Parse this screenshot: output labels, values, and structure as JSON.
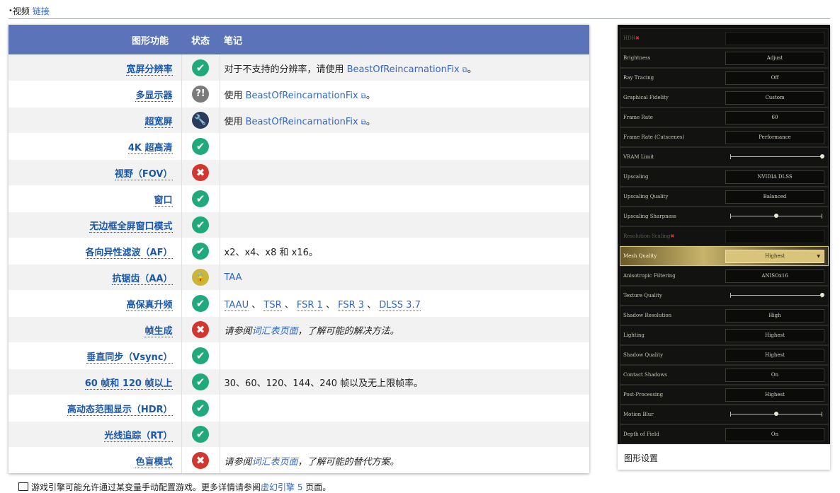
{
  "breadcrumb": {
    "bullet": "•",
    "text": "视频",
    "link": "链接"
  },
  "table": {
    "headers": {
      "feature": "图形功能",
      "status": "状态",
      "notes": "笔记"
    },
    "rows": [
      {
        "feature": "宽屏分辨率",
        "status": "true",
        "notes": {
          "pre": "对于不支持的分辨率，请使用 ",
          "link": "BeastOfReincarnationFix",
          "post": "。"
        }
      },
      {
        "feature": "多显示器",
        "status": "unknown",
        "notes": {
          "pre": "使用 ",
          "link": "BeastOfReincarnationFix",
          "post": "。"
        }
      },
      {
        "feature": "超宽屏",
        "status": "hackable",
        "notes": {
          "pre": "使用 ",
          "link": "BeastOfReincarnationFix",
          "post": "。"
        }
      },
      {
        "feature": "4K 超高清",
        "status": "true",
        "notes": {
          "pre": "",
          "link": "",
          "post": ""
        }
      },
      {
        "feature": "视野（FOV）",
        "status": "false",
        "notes": {
          "pre": "",
          "link": "",
          "post": ""
        }
      },
      {
        "feature": "窗口",
        "status": "true",
        "notes": {
          "pre": "",
          "link": "",
          "post": ""
        }
      },
      {
        "feature": "无边框全屏窗口模式",
        "status": "true",
        "notes": {
          "pre": "",
          "link": "",
          "post": ""
        }
      },
      {
        "feature": "各向异性滤波（AF）",
        "status": "true",
        "notes": {
          "pre": "x2、x4、x8 和 x16。",
          "link": "",
          "post": ""
        }
      },
      {
        "feature": "抗锯齿（AA）",
        "status": "limited",
        "notes": {
          "pre": "",
          "link": "TAA",
          "post": ""
        }
      },
      {
        "feature": "高保真升频",
        "status": "true",
        "notes": {
          "upscalers": [
            "TAAU",
            "TSR",
            "FSR 1",
            "FSR 3",
            "DLSS 3.7"
          ],
          "sep": " 、 "
        }
      },
      {
        "feature": "帧生成",
        "status": "false",
        "notes": {
          "italic_pre": "请参阅",
          "italic_link": "词汇表页面",
          "italic_post": "，了解可能的解决方法。"
        }
      },
      {
        "feature": "垂直同步（Vsync）",
        "status": "true",
        "notes": {
          "pre": "",
          "link": "",
          "post": ""
        }
      },
      {
        "feature": "60 帧和 120 帧以上",
        "status": "true",
        "notes": {
          "pre": "30、60、120、144、240 帧以及无上限帧率。",
          "link": "",
          "post": ""
        }
      },
      {
        "feature": "高动态范围显示（HDR）",
        "status": "true",
        "notes": {
          "pre": "",
          "link": "",
          "post": ""
        }
      },
      {
        "feature": "光线追踪（RT）",
        "status": "true",
        "notes": {
          "pre": "",
          "link": "",
          "post": ""
        }
      },
      {
        "feature": "色盲模式",
        "status": "false",
        "notes": {
          "italic_pre": "请参阅",
          "italic_link": "词汇表页面",
          "italic_post": "，了解可能的替代方案。"
        }
      }
    ]
  },
  "status_icons": {
    "true": "✔",
    "false": "✖",
    "unknown": "?!",
    "hackable": "🔧",
    "limited": "🔒"
  },
  "status_icon_names": {
    "true": "check-circle-icon",
    "false": "cross-circle-icon",
    "unknown": "unknown-status-icon",
    "hackable": "wrench-icon",
    "limited": "lock-icon"
  },
  "external_link_icon": "⧉",
  "note": {
    "icon": "notes-icon",
    "pre": "游戏引擎可能允许通过某变量手动配置游戏。更多详情请参阅",
    "link": "虚幻引擎 5",
    "post": " 页面。"
  },
  "figure": {
    "caption": "图形设置",
    "settings": [
      {
        "label": "HDR",
        "required": true,
        "value": "",
        "dim": true,
        "type": "select"
      },
      {
        "label": "Brightness",
        "value": "Adjust",
        "type": "select"
      },
      {
        "label": "Ray Tracing",
        "value": "Off",
        "type": "select"
      },
      {
        "label": "Graphical Fidelity",
        "value": "Custom",
        "type": "select"
      },
      {
        "label": "Frame Rate",
        "value": "60",
        "type": "select"
      },
      {
        "label": "Frame Rate (Cutscenes)",
        "value": "Performance",
        "type": "select"
      },
      {
        "label": "VRAM Limit",
        "type": "slider",
        "level": 1.0
      },
      {
        "label": "Upscaling",
        "value": "NVIDIA DLSS",
        "type": "select"
      },
      {
        "label": "Upscaling Quality",
        "value": "Balanced",
        "type": "select"
      },
      {
        "label": "Upscaling Sharpness",
        "type": "slider",
        "level": 0.5
      },
      {
        "label": "Resolution Scaling",
        "required": true,
        "value": "",
        "dim": true,
        "type": "select"
      },
      {
        "label": "Mesh Quality",
        "value": "Highest",
        "highlight": true,
        "type": "select"
      },
      {
        "label": "Anisotropic Filtering",
        "value": "ANISOx16",
        "type": "select"
      },
      {
        "label": "Texture Quality",
        "type": "slider",
        "level": 1.0
      },
      {
        "label": "Shadow Resolution",
        "value": "High",
        "type": "select"
      },
      {
        "label": "Lighting",
        "value": "Highest",
        "type": "select"
      },
      {
        "label": "Shadow Quality",
        "value": "Highest",
        "type": "select"
      },
      {
        "label": "Contact Shadows",
        "value": "On",
        "type": "select"
      },
      {
        "label": "Post-Processing",
        "value": "Highest",
        "type": "select"
      },
      {
        "label": "Motion Blur",
        "type": "slider",
        "level": 0.5
      },
      {
        "label": "Depth of Field",
        "value": "On",
        "type": "select"
      }
    ]
  }
}
